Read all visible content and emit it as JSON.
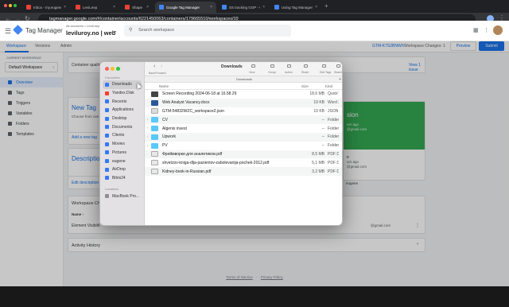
{
  "browser": {
    "tabs": [
      {
        "label": "Inbox - my.eugenel@gmail.com",
        "color": "#ea4335"
      },
      {
        "label": "LeviLeep",
        "color": "#ea4335"
      },
      {
        "label": "Shape",
        "color": "#ea4335"
      },
      {
        "label": "Google Tag Manager",
        "color": "#4285f4"
      },
      {
        "label": "SS tracking GOP - Google Dri...",
        "color": "#4285f4"
      },
      {
        "label": "Using Tag Manager Gr...",
        "color": "#4285f4"
      }
    ],
    "url": "tagmanager.google.com/#/container/accounts/6221450063/containers/179665510/workspaces/10"
  },
  "gtm": {
    "app_title": "Tag Manager",
    "breadcrumb": "All accounts > LeviLeep",
    "container_name": "leviluroy.no | web",
    "search_placeholder": "Search workspace",
    "tabs": [
      "Workspace",
      "Versions",
      "Admin"
    ],
    "container_id": "GTM-K7S2BNWX",
    "workspace_changes": "Workspace Changes: 1",
    "preview_label": "Preview",
    "submit_label": "Submit",
    "current_workspace_label": "CURRENT WORKSPACE",
    "current_workspace": "Default Workspace",
    "nav": [
      "Overview",
      "Tags",
      "Triggers",
      "Variables",
      "Folders",
      "Templates"
    ],
    "container_quality_label": "Container quality",
    "view_issue": "View 1 issue",
    "new_tag_title": "New Tag",
    "new_tag_desc": "Choose from ove",
    "add_new_tag": "Add a new tag",
    "description_title": "Description",
    "edit_description": "Edit description",
    "workspace_changes_title": "Workspace Ch",
    "name_col": "Name ↑",
    "element_visibility": "Element Visibilit",
    "activity_history": "Activity History",
    "version_title": "sion",
    "version_meta1": "urs ago",
    "version_meta2": "@gmail.com",
    "version_meta3": "e",
    "version_meta4": "urs ago",
    "version_meta5": "@gmail.com",
    "version_date1": "eugene",
    "terms": "Terms of Service",
    "privacy": "Privacy Policy"
  },
  "finder": {
    "title": "Downloads",
    "nav_label": "Back/Forward",
    "toolbar": [
      "View",
      "Group",
      "Action",
      "Share",
      "Edit Tags",
      "Search"
    ],
    "path_label": "Downloads",
    "columns": {
      "name": "Name",
      "size": "Size",
      "kind": "Kind"
    },
    "favorites_label": "Favourites",
    "locations_label": "Locations",
    "sidebar": [
      "Downloads",
      "Yandex.Disk",
      "Recents",
      "Applications",
      "Desktop",
      "Documents",
      "Clients",
      "Movies",
      "Pictures",
      "eugene",
      "AirDrop",
      "Bitrix24"
    ],
    "locations": [
      "MacBook Pro..."
    ],
    "files": [
      {
        "name": "Screen Recording 2024-06-18 at 16.58.29",
        "size": "18,6 MB",
        "kind": "QuickTim",
        "type": "video"
      },
      {
        "name": "Web Analyst Vacancy.docx",
        "size": "19 KB",
        "kind": "Word 20",
        "type": "doc"
      },
      {
        "name": "GTM-54832WZC_workspace2.json",
        "size": "10 KB",
        "kind": "JSON Fil",
        "type": "json"
      },
      {
        "name": "CV",
        "size": "--",
        "kind": "Folder",
        "type": "folder"
      },
      {
        "name": "Algenis invest",
        "size": "--",
        "kind": "Folder",
        "type": "folder"
      },
      {
        "name": "Upwork",
        "size": "--",
        "kind": "Folder",
        "type": "folder"
      },
      {
        "name": "PV",
        "size": "--",
        "kind": "Folder",
        "type": "folder"
      },
      {
        "name": "Фреймворки для аналитиков.pdf",
        "size": "8,5 MB",
        "kind": "PDF Doc",
        "type": "pdf"
      },
      {
        "name": "shvetzov-kniga-dlja-pazientov-zabolevanija-pochek-2012.pdf",
        "size": "5,1 MB",
        "kind": "PDF Doc",
        "type": "pdf"
      },
      {
        "name": "Kidney-book-in-Russian.pdf",
        "size": "3,2 MB",
        "kind": "PDF Doc",
        "type": "pdf"
      }
    ]
  }
}
